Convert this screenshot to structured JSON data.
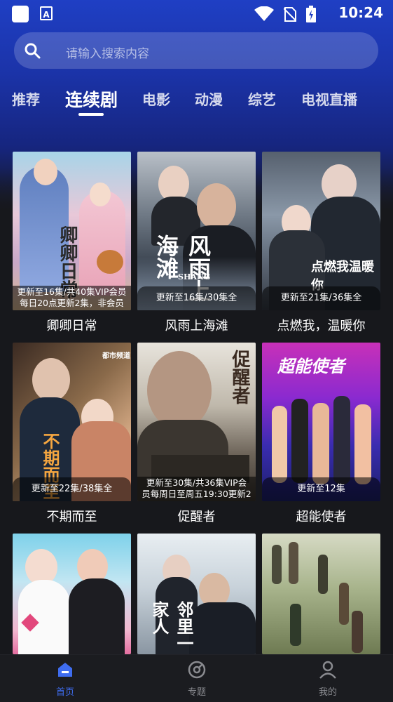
{
  "status_bar": {
    "time": "10:24",
    "app_icon_letter": "A"
  },
  "search": {
    "placeholder": "请输入搜索内容"
  },
  "tabs": [
    {
      "label": "推荐",
      "active": false
    },
    {
      "label": "连续剧",
      "active": true
    },
    {
      "label": "电影",
      "active": false
    },
    {
      "label": "动漫",
      "active": false
    },
    {
      "label": "综艺",
      "active": false
    },
    {
      "label": "电视直播",
      "active": false
    }
  ],
  "cards": [
    {
      "title": "卿卿日常",
      "badge": [
        "更新至16集/共40集VIP会员",
        "每日20点更新2集，非会员"
      ],
      "poster_text": "卿卿日常"
    },
    {
      "title": "风雨上海滩",
      "badge": [
        "更新至16集/30集全"
      ],
      "poster_text": "风雨上海滩",
      "poster_subtext": "SHANG"
    },
    {
      "title": "点燃我，温暖你",
      "badge": [
        "更新至21集/36集全"
      ],
      "poster_text": "点燃我温暖你"
    },
    {
      "title": "不期而至",
      "badge": [
        "更新至22集/38集全"
      ],
      "poster_text": "不期而至",
      "poster_subtext": "都市频道"
    },
    {
      "title": "促醒者",
      "badge": [
        "更新至30集/共36集VIP会",
        "员每周日至周五19:30更新2"
      ],
      "poster_text": "促醒者"
    },
    {
      "title": "超能使者",
      "badge": [
        "更新至12集"
      ],
      "poster_text": "超能使者"
    },
    {
      "title": "",
      "badge": [],
      "poster_text": ""
    },
    {
      "title": "",
      "badge": [],
      "poster_text": "邻里一家人"
    },
    {
      "title": "",
      "badge": [],
      "poster_text": ""
    }
  ],
  "bottom_nav": [
    {
      "label": "首页",
      "icon": "home-icon",
      "active": true
    },
    {
      "label": "专题",
      "icon": "topic-icon",
      "active": false
    },
    {
      "label": "我的",
      "icon": "user-icon",
      "active": false
    }
  ],
  "colors": {
    "accent": "#3f6df0",
    "header_blue": "#1f3fc4",
    "background": "#17181c"
  }
}
